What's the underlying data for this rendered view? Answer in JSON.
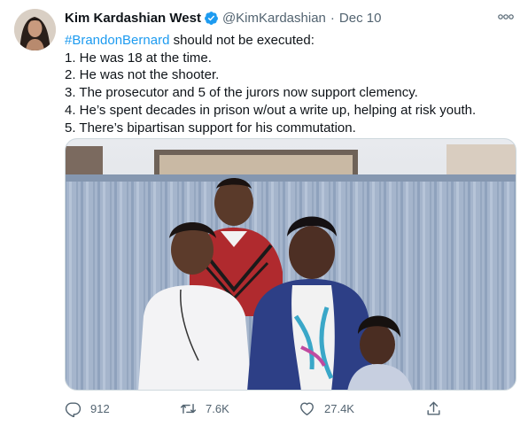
{
  "author": {
    "name": "Kim Kardashian West",
    "handle": "@KimKardashian",
    "separator": "·",
    "date": "Dec 10"
  },
  "tweet": {
    "hashtag": "#BrandonBernard",
    "lines": [
      " should not be executed:",
      "1. He was 18 at the time.",
      "2. He was not the shooter.",
      "3. The prosecutor and 5 of the jurors now support clemency.",
      "4. He’s spent decades in prison w/out a write up, helping at risk youth.",
      "5. There’s bipartisan support for his commutation."
    ]
  },
  "actions": {
    "replies": "912",
    "retweets": "7.6K",
    "likes": "27.4K"
  },
  "icons": {
    "verified": "verified-badge-icon",
    "more": "more-options-icon",
    "reply": "reply-icon",
    "retweet": "retweet-icon",
    "like": "like-icon",
    "share": "share-icon"
  },
  "colors": {
    "accent": "#1d9bf0",
    "secondary_text": "#536471",
    "primary_text": "#0f1419"
  }
}
